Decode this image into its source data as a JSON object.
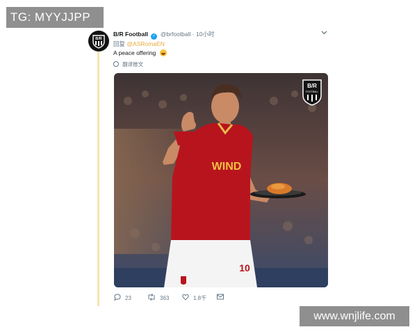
{
  "watermarks": {
    "top_left": "TG: MYYJJPP",
    "bottom_right": "www.wnjlife.com"
  },
  "tweet": {
    "display_name": "B/R Football",
    "handle": "@brfootball",
    "separator": "·",
    "time": "10小时",
    "reply_prefix": "回复",
    "reply_mention": "@ASRomaEN",
    "text": "A peace offering",
    "emoji": "rolling-on-the-floor-laughing",
    "translate_label": "翻译推文",
    "avatar_text": "B/R",
    "media": {
      "badge_text": "B/R",
      "badge_subtext": "FOOTBALL",
      "shirt_sponsor": "WIND",
      "shirt_number": "10",
      "colors": {
        "shirt": "#b8141e",
        "shorts": "#f4f4f4",
        "stadium": "#4a3a3a"
      }
    },
    "actions": {
      "replies": "23",
      "retweets": "363",
      "likes": "1.8千"
    }
  },
  "colors": {
    "thread_line": "#f4e3b0",
    "mention": "#e8a93a",
    "verified": "#1da1f2",
    "muted": "#657786"
  }
}
